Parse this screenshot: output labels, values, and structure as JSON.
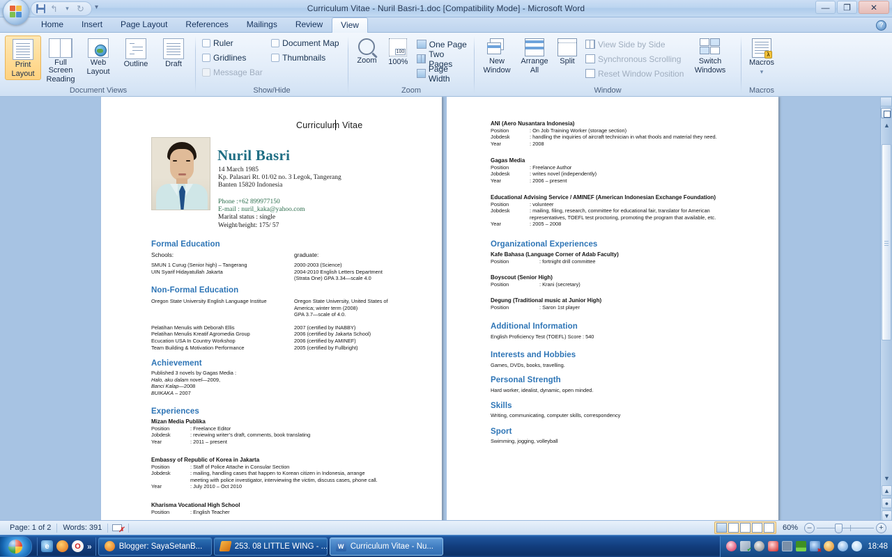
{
  "window": {
    "title": "Curriculum Vitae - Nuril Basri-1.doc [Compatibility Mode] - Microsoft Word",
    "minimize": "—",
    "maximize": "❐",
    "close": "✕",
    "office_button": "office-orb",
    "quick_access": {
      "save": "Save",
      "undo": "Undo",
      "redo": "Redo",
      "customize": "Customize Quick Access Toolbar"
    },
    "help": "?"
  },
  "ribbon": {
    "tabs": [
      {
        "label": "Home",
        "active": false
      },
      {
        "label": "Insert",
        "active": false
      },
      {
        "label": "Page Layout",
        "active": false
      },
      {
        "label": "References",
        "active": false
      },
      {
        "label": "Mailings",
        "active": false
      },
      {
        "label": "Review",
        "active": false
      },
      {
        "label": "View",
        "active": true
      }
    ],
    "groups": {
      "document_views": {
        "label": "Document Views",
        "buttons": [
          {
            "line1": "Print",
            "line2": "Layout",
            "selected": true
          },
          {
            "line1": "Full Screen",
            "line2": "Reading",
            "selected": false
          },
          {
            "line1": "Web",
            "line2": "Layout",
            "selected": false
          },
          {
            "line1": "Outline",
            "line2": "",
            "selected": false
          },
          {
            "line1": "Draft",
            "line2": "",
            "selected": false
          }
        ]
      },
      "show_hide": {
        "label": "Show/Hide",
        "col1": [
          {
            "label": "Ruler",
            "checked": false,
            "disabled": false
          },
          {
            "label": "Gridlines",
            "checked": false,
            "disabled": false
          },
          {
            "label": "Message Bar",
            "checked": false,
            "disabled": true
          }
        ],
        "col2": [
          {
            "label": "Document Map",
            "checked": false,
            "disabled": false
          },
          {
            "label": "Thumbnails",
            "checked": false,
            "disabled": false
          }
        ]
      },
      "zoom": {
        "label": "Zoom",
        "zoom_button": "Zoom",
        "hundred_button": "100%",
        "items": [
          {
            "label": "One Page"
          },
          {
            "label": "Two Pages"
          },
          {
            "label": "Page Width"
          }
        ]
      },
      "window": {
        "label": "Window",
        "new_window": {
          "line1": "New",
          "line2": "Window"
        },
        "arrange_all": {
          "line1": "Arrange",
          "line2": "All"
        },
        "split": {
          "line1": "Split",
          "line2": ""
        },
        "items": [
          {
            "label": "View Side by Side",
            "disabled": true
          },
          {
            "label": "Synchronous Scrolling",
            "disabled": true
          },
          {
            "label": "Reset Window Position",
            "disabled": true
          }
        ],
        "switch_windows": {
          "line1": "Switch",
          "line2": "Windows"
        }
      },
      "macros": {
        "label": "Macros",
        "button": "Macros"
      }
    }
  },
  "document": {
    "header": "Curriculum Vitae",
    "name": "Nuril Basri",
    "birth": "14  March 1985",
    "address1": "Kp. Palasari Rt. 01/02 no. 3 Legok, Tangerang",
    "address2": "Banten 15820 Indonesia",
    "phone": "Phone  :+62 899977150",
    "email": "E-mail : nuril_kaka@yahoo.com",
    "marital": "Marital status  : single",
    "weight": "Weight/height: 175/ 57",
    "sections": {
      "formal_education": {
        "title": "Formal Education",
        "col_left_head": "Schools:",
        "col_right_head": "graduate:",
        "rows_left": [
          "SMUN 1 Curug (Senior high) – Tangerang",
          "UIN Syarif Hidayatullah Jakarta"
        ],
        "rows_right": [
          "2000-2003 (Science)",
          "2004-2010 English Letters Department",
          "(Strata One) GPA 3.34—scale 4.0"
        ]
      },
      "non_formal_education": {
        "title": "Non-Formal Education",
        "left": [
          " Oregon State University English Language Institue",
          "",
          "",
          "Pelatihan Menulis with Deborah Ellis",
          "Pelatihan Menulis Kreatif Agromedia Group",
          "Ecucation USA In Country Workshop",
          "Team Building & Motivation Performance"
        ],
        "right": [
          "Oregon State University, United States of",
          "America; winter term (2008)",
          " GPA 3.7—scale of 4.0.",
          "2007 (certified by INABBY)",
          "2006 (certified by Jakarta School)",
          "2006 (certified by AMINEF)",
          "2005 (certified by Fullbright)"
        ]
      },
      "achievement": {
        "title": "Achievement",
        "intro": "Published 3 novels by Gagas Media :",
        "items": [
          {
            "italic": "Halo, aku dalam novel",
            "rest": "—2009,"
          },
          {
            "italic": "Banci Kalap",
            "rest": "—2008"
          },
          {
            "italic": "BUIKAKA",
            "rest": " – 2007"
          }
        ]
      },
      "experiences": {
        "title": "Experiences",
        "entries": [
          {
            "org": "Mizan Media Publika",
            "rows": [
              {
                "k": "Position",
                "v": ": Freelance Editor"
              },
              {
                "k": "Jobdesk",
                "v": ": reviewing writer’s draft, comments, book translating"
              },
              {
                "k": "Year",
                "v": ": 2011 – present"
              }
            ]
          },
          {
            "org": "Embassy of Republic of Korea in Jakarta",
            "rows": [
              {
                "k": "Position",
                "v": ": Staff of Police Attache in Consular Section"
              },
              {
                "k": "Jobdesk",
                "v": ": mailing, handling cases that happen to Korean citizen in Indonesia, arrange"
              },
              {
                "k": "",
                "v": "  meeting with police investigator, interviewing the victim, discuss cases, phone call."
              },
              {
                "k": "Year",
                "v": ": July 2010 – Oct 2010"
              }
            ]
          },
          {
            "org": "Kharisma Vocational High School",
            "rows": [
              {
                "k": "Position",
                "v": ": English Teacher"
              }
            ]
          }
        ]
      }
    },
    "page2": {
      "experiences_cont": [
        {
          "org": "ANI (Aero Nusantara Indonesia)",
          "rows": [
            {
              "k": "Position",
              "v": ": On Job Training Worker (storage section)"
            },
            {
              "k": "Jobdesk",
              "v": ": handling the inquiries of aircraft technician in what thools and material they need."
            },
            {
              "k": "Year",
              "v": ": 2008"
            }
          ]
        },
        {
          "org": "Gagas Media",
          "rows": [
            {
              "k": "Position",
              "v": ": Freelance Author"
            },
            {
              "k": "Jobdesk",
              "v": ": writes novel (independently)"
            },
            {
              "k": "Year",
              "v": ": 2006 – present"
            }
          ]
        },
        {
          "org": "Educational Advising Service / AMINEF (American Indonesian Exchange Foundation)",
          "rows": [
            {
              "k": "Position",
              "v": ": volunteer"
            },
            {
              "k": "Jobdesk",
              "v": ": mailing, filing, research, committee for educational fair,  translator for American"
            },
            {
              "k": "",
              "v": "  representatives, TOEFL test proctoring, promoting the program that available, etc."
            },
            {
              "k": "Year",
              "v": ": 2005 – 2008"
            }
          ]
        }
      ],
      "organizational": {
        "title": "Organizational Experiences",
        "entries": [
          {
            "org": "Kafe Bahasa (Language Corner of Adab Faculty)",
            "k": "Position",
            "v": ": fortnight drill committee"
          },
          {
            "org": "Boyscout (Senior High)",
            "k": "Position",
            "v": ": Krani (secretary)"
          },
          {
            "org": "Degung (Traditional music at Junior High)",
            "k": "Position",
            "v": ": Saron 1st player"
          }
        ]
      },
      "additional": {
        "title": "Additional Information",
        "text": "English Proficiency Test (TOEFL) Score : 540"
      },
      "interests": {
        "title": "Interests and Hobbies",
        "text": "Games, DVDs, books, travelling."
      },
      "strength": {
        "title": "Personal Strength",
        "text": "Hard worker, idealist, dynamic, open minded."
      },
      "skills": {
        "title": "Skills",
        "text": "Writing, communicating, computer skills, correspondency"
      },
      "sport": {
        "title": "Sport",
        "text": "Swimming, jogging, volleyball"
      }
    }
  },
  "status_bar": {
    "page": "Page: 1 of 2",
    "words": "Words: 391",
    "proofing": "proofing-errors-icon",
    "zoom_level": "60%",
    "zoom_out": "–",
    "zoom_in": "+"
  },
  "taskbar": {
    "start": "Start",
    "quick_launch": [
      "internet-explorer-icon",
      "firefox-icon",
      "opera-icon"
    ],
    "more": "»",
    "buttons": [
      {
        "label": "Blogger: SayaSetanB...",
        "active": false
      },
      {
        "label": "253. 08 LITTLE WING - ...",
        "active": false
      },
      {
        "label": "Curriculum Vitae - Nu...",
        "active": true
      }
    ],
    "clock": "18:48"
  }
}
